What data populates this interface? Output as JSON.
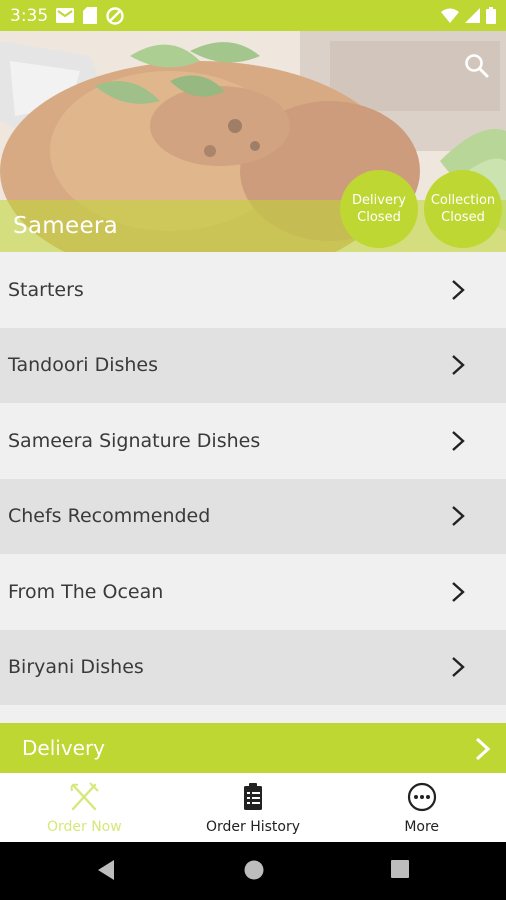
{
  "status_bar": {
    "time": "3:35",
    "left_icons": [
      "gmail-icon",
      "sim-card-icon",
      "do-not-disturb-icon"
    ],
    "right_icons": [
      "wifi-icon",
      "signal-icon",
      "battery-icon"
    ]
  },
  "hero": {
    "restaurant_name": "Sameera",
    "image": "tandoori-chicken-photo",
    "delivery_badge": {
      "line1": "Delivery",
      "line2": "Closed"
    },
    "collection_badge": {
      "line1": "Collection",
      "line2": "Closed"
    }
  },
  "menu": {
    "items": [
      {
        "label": "Starters"
      },
      {
        "label": "Tandoori Dishes"
      },
      {
        "label": "Sameera Signature Dishes"
      },
      {
        "label": "Chefs Recommended"
      },
      {
        "label": "From The Ocean"
      },
      {
        "label": "Biryani Dishes"
      }
    ]
  },
  "delivery_bar": {
    "label": "Delivery"
  },
  "bottom_nav": {
    "items": [
      {
        "label": "Order Now",
        "icon": "fork-knife-icon",
        "active": true
      },
      {
        "label": "Order History",
        "icon": "clipboard-icon",
        "active": false
      },
      {
        "label": "More",
        "icon": "more-icon",
        "active": false
      }
    ]
  },
  "colors": {
    "accent": "#bfd732",
    "list_light": "#f0f0f0",
    "list_dark": "#e1e1e1",
    "active_nav": "#d6e87a"
  }
}
